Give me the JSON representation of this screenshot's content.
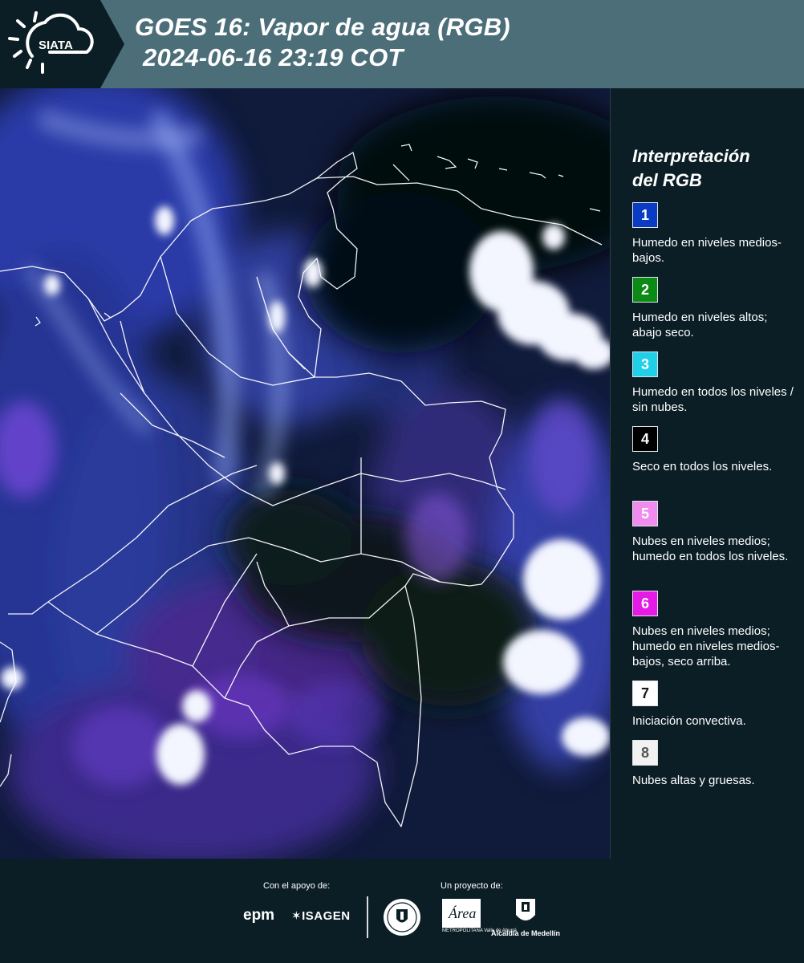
{
  "header": {
    "brand": "SIATA",
    "title_line1": "GOES 16: Vapor de agua (RGB)",
    "title_line2": "2024-06-16 23:19 COT",
    "colors": {
      "background": "#4b6e79",
      "logo_block": "#0b1e26"
    }
  },
  "map": {
    "description_icon": "satellite-water-vapor-map",
    "colors": {
      "dry": "#0d1628",
      "blue": "#2f3fb0",
      "violet": "#6a3fd0",
      "cloud": "#f2f4ff",
      "borders": "#ffffff"
    }
  },
  "legend": {
    "title_line1": "Interpretación",
    "title_line2": "del RGB",
    "items": [
      {
        "number": "1",
        "color": "#0a3bc4",
        "text": "Humedo en niveles medios-bajos."
      },
      {
        "number": "2",
        "color": "#0b8a16",
        "text": "Humedo en niveles altos; abajo seco."
      },
      {
        "number": "3",
        "color": "#1fd0e8",
        "text": "Humedo en todos los niveles / sin nubes."
      },
      {
        "number": "4",
        "color": "#000000",
        "text": "Seco en todos los niveles."
      },
      {
        "number": "5",
        "color": "#f08cf0",
        "text": "Nubes en niveles medios; humedo en todos los niveles."
      },
      {
        "number": "6",
        "color": "#e61ae6",
        "text": "Nubes en niveles medios; humedo en niveles medios-bajos, seco arriba."
      },
      {
        "number": "7",
        "color": "#ffffff",
        "text": "Iniciación convectiva.",
        "number_color": "#1a1a1a"
      },
      {
        "number": "8",
        "color": "#f2f2f2",
        "text": "Nubes altas y gruesas.",
        "number_color": "#555555"
      }
    ]
  },
  "footer": {
    "support_label": "Con el apoyo de:",
    "project_label": "Un proyecto de:",
    "sponsors": {
      "epm": "epm",
      "isagen": "ISAGEN"
    },
    "partners": {
      "area": "Área",
      "area_sub": "METROPOLITANA Valle de Aburrá",
      "alcaldia": "Alcaldía de Medellín"
    }
  }
}
